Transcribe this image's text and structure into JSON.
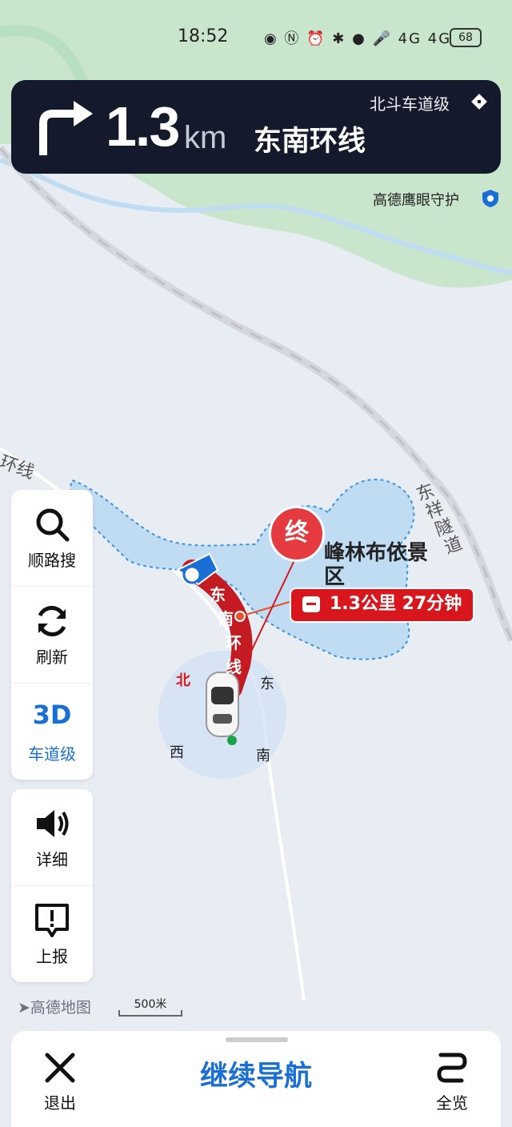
{
  "status_bar": {
    "time": "18:52",
    "battery": "68",
    "net1": "4G",
    "net2": "4G"
  },
  "nav": {
    "distance": "1.3",
    "unit": "km",
    "road": "东南环线",
    "lane_level": "北斗车道级"
  },
  "eye_guard": "高德鹰眼守护",
  "map": {
    "road_tunnel": [
      "东",
      "祥",
      "隧",
      "道"
    ],
    "road_left": "环线",
    "poi": "峰林布依景区",
    "route_road": [
      "东",
      "南",
      "环",
      "线"
    ],
    "end_label": "终",
    "route_info": "1.3公里 27分钟",
    "compass": {
      "n": "北",
      "e": "东",
      "s": "南",
      "w": "西"
    },
    "logo": "高德地图",
    "scale": "500米"
  },
  "panel1": [
    {
      "label": "顺路搜",
      "icon": "search-icon"
    },
    {
      "label": "刷新",
      "icon": "refresh-icon"
    },
    {
      "big": "3D",
      "label": "车道级",
      "icon": "3d-lane-toggle"
    }
  ],
  "panel2": [
    {
      "label": "详细",
      "icon": "speaker-icon"
    },
    {
      "label": "上报",
      "icon": "report-icon"
    }
  ],
  "bottom": {
    "exit": "退出",
    "continue": "继续导航",
    "overview": "全览"
  },
  "colors": {
    "route": "#d8161d",
    "accent": "#1a6fd6",
    "banner": "#141a2b",
    "water": "#bfdcf3",
    "green": "#c9e6cc"
  }
}
